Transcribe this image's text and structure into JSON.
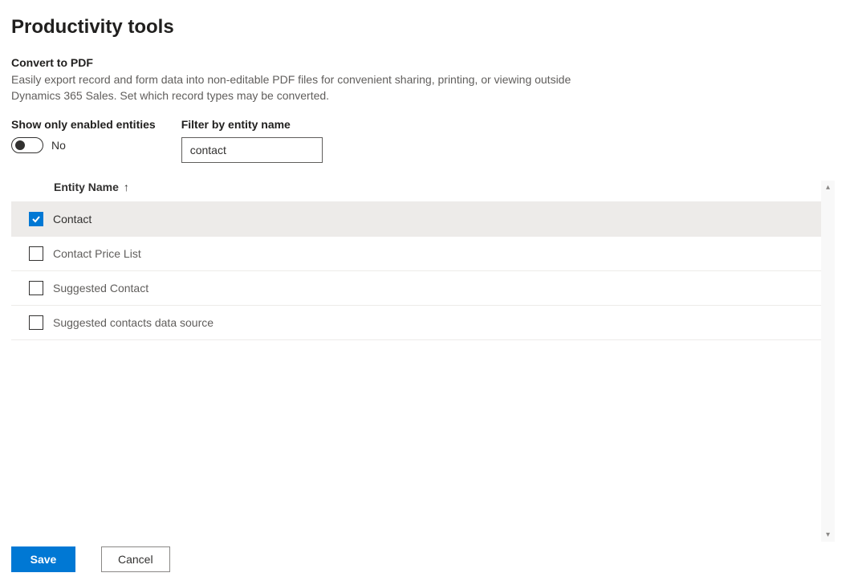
{
  "page": {
    "title": "Productivity tools"
  },
  "section": {
    "title": "Convert to PDF",
    "description": "Easily export record and form data into non-editable PDF files for convenient sharing, printing, or viewing outside Dynamics 365 Sales. Set which record types may be converted."
  },
  "controls": {
    "show_only_enabled": {
      "label": "Show only enabled entities",
      "value_text": "No",
      "enabled": false
    },
    "filter": {
      "label": "Filter by entity name",
      "value": "contact"
    }
  },
  "table": {
    "column_header": "Entity Name",
    "sort_direction": "asc",
    "rows": [
      {
        "name": "Contact",
        "checked": true
      },
      {
        "name": "Contact Price List",
        "checked": false
      },
      {
        "name": "Suggested Contact",
        "checked": false
      },
      {
        "name": "Suggested contacts data source",
        "checked": false
      }
    ]
  },
  "footer": {
    "save_label": "Save",
    "cancel_label": "Cancel"
  }
}
